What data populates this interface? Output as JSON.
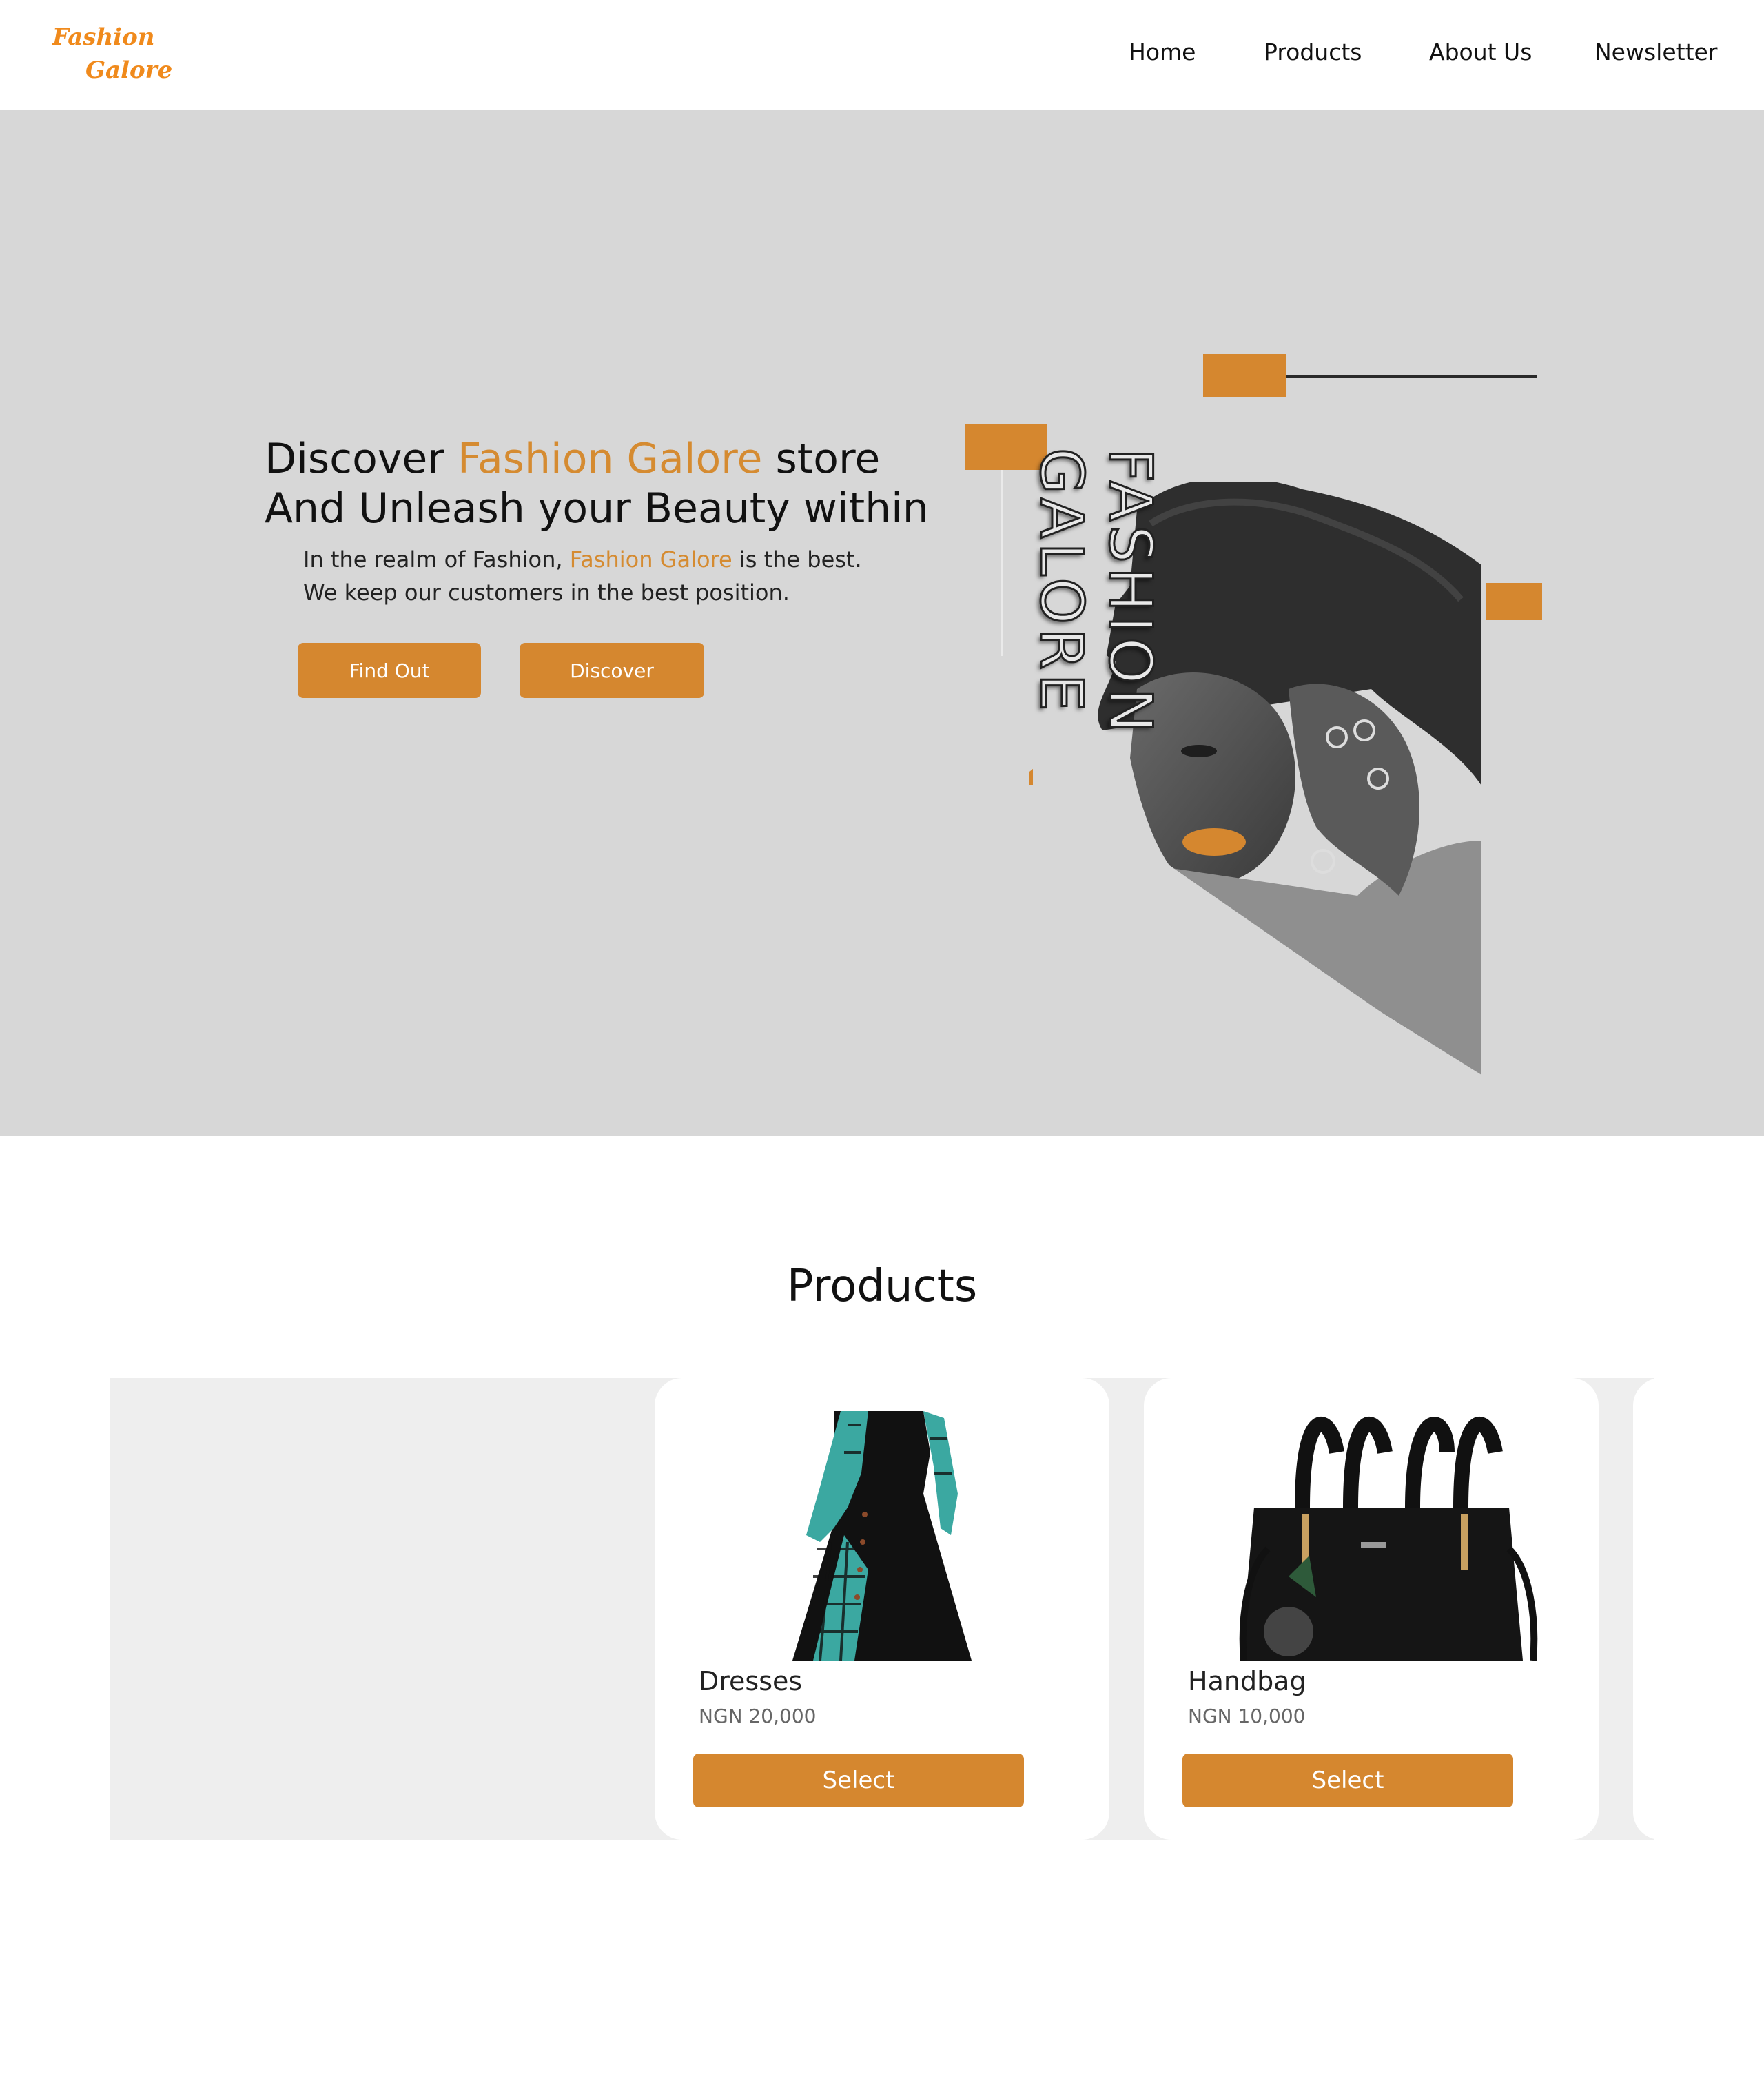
{
  "brand": {
    "line1": "Fashion",
    "line2": "Galore",
    "color": "#f08a1c"
  },
  "nav": {
    "items": [
      {
        "label": "Home"
      },
      {
        "label": "Products"
      },
      {
        "label": "About Us"
      },
      {
        "label": "Newsletter"
      }
    ]
  },
  "hero": {
    "headline_pre": "Discover ",
    "headline_accent": "Fashion Galore",
    "headline_post": " store",
    "headline_line2": "And Unleash your Beauty within",
    "sub_line1_pre": "In the realm of Fashion, ",
    "sub_line1_accent": "Fashion Galore",
    "sub_line1_post": " is the best.",
    "sub_line2": "We keep our customers in the best position.",
    "buttons": {
      "find_out": "Find Out",
      "discover": "Discover"
    },
    "vertical_text": "FASHION GALORE"
  },
  "products": {
    "title": "Products",
    "items": [
      {
        "name": "Dresses",
        "price": "NGN 20,000",
        "button": "Select"
      },
      {
        "name": "Handbag",
        "price": "NGN 10,000",
        "button": "Select"
      }
    ]
  },
  "colors": {
    "accent": "#d5872f",
    "hero_bg": "#d7d7d7",
    "strip_bg": "#eeeeee"
  }
}
